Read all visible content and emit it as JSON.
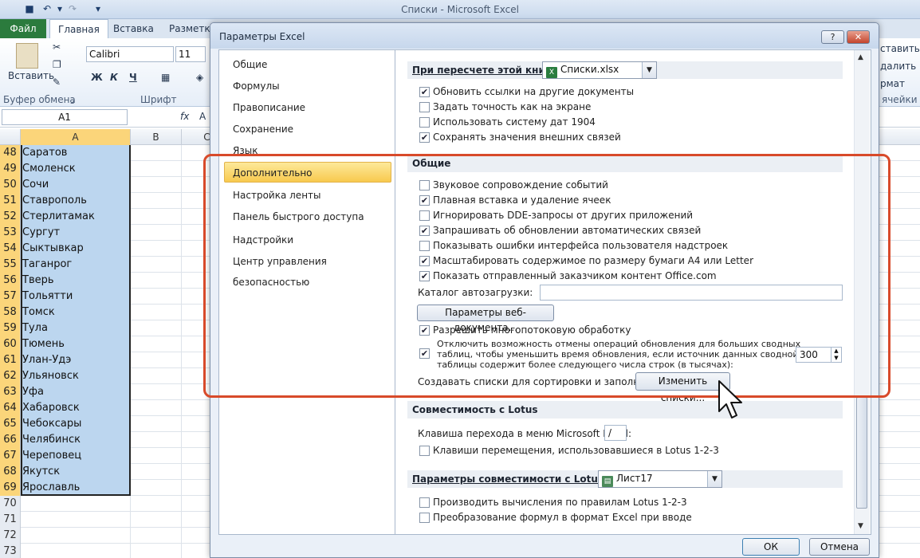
{
  "excel": {
    "window_title": "Списки  -  Microsoft Excel",
    "tabs": {
      "file": "Файл",
      "home": "Главная",
      "insert": "Вставка",
      "layout": "Разметка"
    },
    "ribbon": {
      "paste_label": "Вставить",
      "font_name": "Calibri",
      "font_size": "11",
      "bold": "Ж",
      "italic": "К",
      "underline": "Ч",
      "group_clipboard": "Буфер обмена",
      "group_font": "Шрифт",
      "right_items": [
        "ставить",
        "далить",
        "рмат",
        "ячейки"
      ]
    },
    "name_box": "A1",
    "fx": "fx",
    "formula_partial": "A",
    "columns": [
      "A",
      "B",
      "C"
    ],
    "rows": [
      {
        "n": "48",
        "v": "Саратов"
      },
      {
        "n": "49",
        "v": "Смоленск"
      },
      {
        "n": "50",
        "v": "Сочи"
      },
      {
        "n": "51",
        "v": "Ставрополь"
      },
      {
        "n": "52",
        "v": "Стерлитамак"
      },
      {
        "n": "53",
        "v": "Сургут"
      },
      {
        "n": "54",
        "v": "Сыктывкар"
      },
      {
        "n": "55",
        "v": "Таганрог"
      },
      {
        "n": "56",
        "v": "Тверь"
      },
      {
        "n": "57",
        "v": "Тольятти"
      },
      {
        "n": "58",
        "v": "Томск"
      },
      {
        "n": "59",
        "v": "Тула"
      },
      {
        "n": "60",
        "v": "Тюмень"
      },
      {
        "n": "61",
        "v": "Улан-Удэ"
      },
      {
        "n": "62",
        "v": "Ульяновск"
      },
      {
        "n": "63",
        "v": "Уфа"
      },
      {
        "n": "64",
        "v": "Хабаровск"
      },
      {
        "n": "65",
        "v": "Чебоксары"
      },
      {
        "n": "66",
        "v": "Челябинск"
      },
      {
        "n": "67",
        "v": "Череповец"
      },
      {
        "n": "68",
        "v": "Якутск"
      },
      {
        "n": "69",
        "v": "Ярославль"
      },
      {
        "n": "70",
        "v": ""
      },
      {
        "n": "71",
        "v": ""
      },
      {
        "n": "72",
        "v": ""
      },
      {
        "n": "73",
        "v": ""
      }
    ]
  },
  "dialog": {
    "title": "Параметры Excel",
    "help_btn": "?",
    "close_btn": "✕",
    "nav": [
      "Общие",
      "Формулы",
      "Правописание",
      "Сохранение",
      "Язык",
      "Дополнительно",
      "Настройка ленты",
      "Панель быстрого доступа",
      "Надстройки",
      "Центр управления безопасностью"
    ],
    "recalc": {
      "header": "При пересчете этой книги:",
      "workbook": "Списки.xlsx",
      "options": [
        {
          "label": "Обновить ссылки на другие документы",
          "checked": true
        },
        {
          "label": "Задать точность как на экране",
          "checked": false
        },
        {
          "label": "Использовать систему дат 1904",
          "checked": false
        },
        {
          "label": "Сохранять значения внешних связей",
          "checked": true
        }
      ]
    },
    "general": {
      "header": "Общие",
      "options": [
        {
          "label": "Звуковое сопровождение событий",
          "checked": false
        },
        {
          "label": "Плавная вставка и удаление ячеек",
          "checked": true
        },
        {
          "label": "Игнорировать DDE-запросы от других приложений",
          "checked": false
        },
        {
          "label": "Запрашивать об обновлении автоматических связей",
          "checked": true
        },
        {
          "label": "Показывать ошибки интерфейса пользователя надстроек",
          "checked": false
        },
        {
          "label": "Масштабировать содержимое по размеру бумаги A4 или Letter",
          "checked": true
        },
        {
          "label": "Показать отправленный заказчиком контент Office.com",
          "checked": true
        }
      ],
      "startup_label": "Каталог автозагрузки:",
      "startup_value": "",
      "web_options_btn": "Параметры веб-документа...",
      "multithread": {
        "label": "Разрешить многопотоковую обработку",
        "checked": true
      },
      "pivot_undo": {
        "lines": [
          "Отключить возможность отмены операций обновления для больших сводных",
          "таблиц, чтобы уменьшить время обновления, если источник данных сводной",
          "таблицы содержит более следующего числа строк (в тысячах):"
        ],
        "checked": true,
        "value": "300"
      },
      "custom_lists_label": "Создавать списки для сортировки и заполнения:",
      "edit_lists_btn": "Изменить списки..."
    },
    "lotus": {
      "header": "Совместимость с Lotus",
      "menu_key_label": "Клавиша перехода в меню Microsoft Excel:",
      "menu_key_value": "/",
      "nav_keys": {
        "label": "Клавиши перемещения, использовавшиеся в Lotus 1-2-3",
        "checked": false
      }
    },
    "lotus_settings": {
      "header": "Параметры совместимости с Lotus для:",
      "sheet": "Лист17",
      "options": [
        {
          "label": "Производить вычисления по правилам Lotus 1-2-3",
          "checked": false
        },
        {
          "label": "Преобразование формул в формат Excel при вводе",
          "checked": false
        }
      ]
    },
    "ok_btn": "ОК",
    "cancel_btn": "Отмена"
  },
  "colors": {
    "highlight_frame": "#d84a2a",
    "nav_active": "#f8c94e",
    "selection": "#bcd6ef",
    "file_tab": "#2b7b3d"
  }
}
